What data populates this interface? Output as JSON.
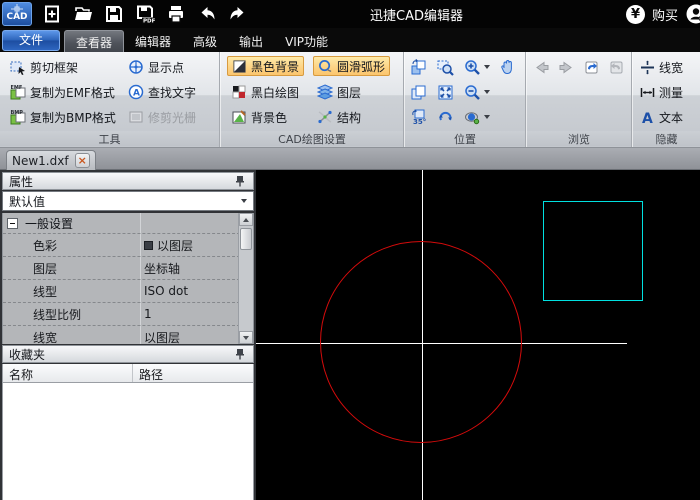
{
  "colors": {
    "canvas-bg": "#000000",
    "crosshair": "#ffffff",
    "circle": "#d40b0b",
    "rect": "#00e0e0",
    "toggle-top": "#fdeaa9",
    "toggle-bottom": "#fbc56d",
    "toggle-border": "#d89b3f"
  },
  "titlebar": {
    "title": "迅捷CAD编辑器",
    "buy_label": "购买",
    "icons": [
      "cad-logo",
      "new-file-icon",
      "open-folder-icon",
      "save-icon",
      "save-pdf-icon",
      "print-icon",
      "undo-icon",
      "redo-icon",
      "yuan-icon",
      "account-icon"
    ]
  },
  "menubar": {
    "file": "文件",
    "tabs": [
      {
        "label": "查看器",
        "active": true
      },
      {
        "label": "编辑器",
        "active": false
      },
      {
        "label": "高级",
        "active": false
      },
      {
        "label": "输出",
        "active": false
      },
      {
        "label": "VIP功能",
        "active": false
      }
    ]
  },
  "ribbon": {
    "groups": [
      {
        "label": "工具"
      },
      {
        "label": "CAD绘图设置"
      },
      {
        "label": "位置"
      },
      {
        "label": "浏览"
      },
      {
        "label": "隐藏"
      }
    ],
    "tools": {
      "cut_frame": "剪切框架",
      "copy_emf": "复制为EMF格式",
      "copy_bmp": "复制为BMP格式",
      "show_points": "显示点",
      "find_text": "查找文字",
      "trim_raster": "修剪光栅"
    },
    "cad_settings": {
      "black_bg": "黑色背景",
      "bw_drawing": "黑白绘图",
      "bg_color": "背景色",
      "smooth_arc": "圆滑弧形",
      "layers": "图层",
      "structure": "结构"
    },
    "position_icons": [
      "rotate-view-icon",
      "zoom-window-icon",
      "zoom-in-icon",
      "pan-icon",
      "copy-view-icon",
      "zoom-extents-icon",
      "zoom-out-icon",
      "rotate-35-icon",
      "refresh-view-icon",
      "sphere-zoom-icon"
    ],
    "browse_icons": [
      "back-arrow-icon",
      "forward-arrow-icon",
      "view-undo-icon",
      "view-redo-icon"
    ],
    "hide": {
      "line_width": "线宽",
      "measure": "测量",
      "text": "文本"
    }
  },
  "tabbar": {
    "tabs": [
      {
        "label": "New1.dxf"
      }
    ]
  },
  "properties": {
    "title": "属性",
    "preset": "默认值",
    "section": "一般设置",
    "rows": [
      {
        "label": "色彩",
        "value": "以图层"
      },
      {
        "label": "图层",
        "value": "坐标轴"
      },
      {
        "label": "线型",
        "value": "ISO dot"
      },
      {
        "label": "线型比例",
        "value": "1"
      },
      {
        "label": "线宽",
        "value": "以图层"
      }
    ]
  },
  "favorites": {
    "title": "收藏夹",
    "columns": [
      {
        "label": "名称"
      },
      {
        "label": "路径"
      }
    ]
  }
}
